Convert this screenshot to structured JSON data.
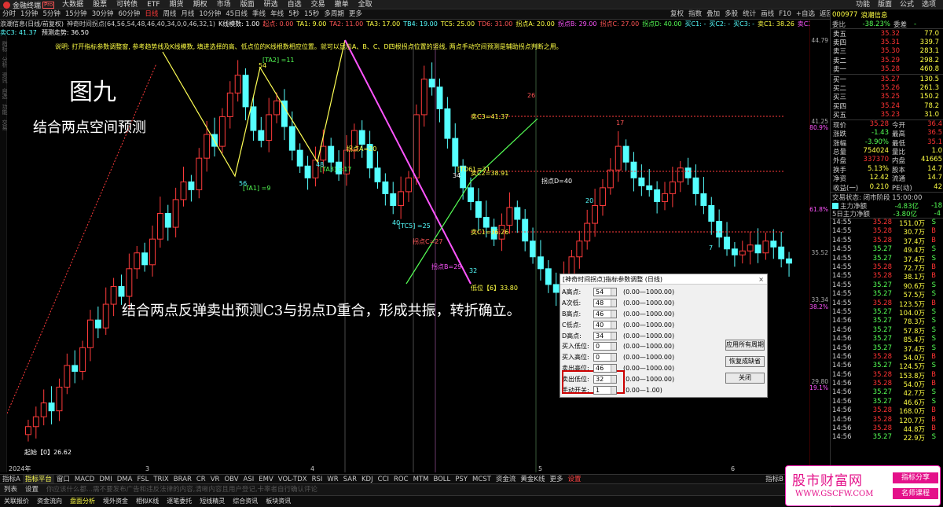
{
  "app": {
    "name": "金融终端",
    "tag": "Pro",
    "menu": [
      "大数据",
      "股票",
      "可转债",
      "ETF",
      "期货",
      "期权",
      "市场",
      "版面",
      "研选",
      "自选",
      "交易",
      "撤单",
      "全取"
    ],
    "right_menu": [
      "功能",
      "版面",
      "公式",
      "选项"
    ]
  },
  "toolbar": {
    "periods": [
      "分时",
      "1分钟",
      "5分钟",
      "15分钟",
      "30分钟",
      "60分钟",
      "日线",
      "周线",
      "月线",
      "10分钟",
      "45日线",
      "季线",
      "年线",
      "5秒",
      "15秒",
      "多周期",
      "更多"
    ],
    "active": "日线",
    "right": [
      "复权",
      "指数",
      "叠加",
      "多股",
      "统计",
      "画线",
      "F10",
      "+自选",
      "返回"
    ]
  },
  "infobar": {
    "stock": "浪潮信息(日线/前复权)",
    "indicator": "神奇时间拐点(64,56,54,48,46,40,34,0,0,46,32,1)",
    "kline": "K线模数: 1.00",
    "items": [
      {
        "t": "起点: 0.00",
        "c": "#f55"
      },
      {
        "t": "TA1: 9.00",
        "c": "#ff4"
      },
      {
        "t": "TA2: 11.00",
        "c": "#f55"
      },
      {
        "t": "TA3: 17.00",
        "c": "#ff4"
      },
      {
        "t": "TB4: 19.00",
        "c": "#5ff"
      },
      {
        "t": "TC5: 25.00",
        "c": "#ff4"
      },
      {
        "t": "TD6: 31.00",
        "c": "#f55"
      },
      {
        "t": "拐点A: 20.00",
        "c": "#ff4"
      },
      {
        "t": "拐点B: 29.00",
        "c": "#f5f"
      },
      {
        "t": "拐点C: 27.00",
        "c": "#f55"
      },
      {
        "t": "拐点D: 40.00",
        "c": "#5f5"
      },
      {
        "t": "买C1: -",
        "c": "#5ff"
      },
      {
        "t": "买C2: -",
        "c": "#5ff"
      },
      {
        "t": "买C3: -",
        "c": "#5ff"
      },
      {
        "t": "卖C1: 38.26",
        "c": "#ff4"
      },
      {
        "t": "卖C2: 38.91",
        "c": "#f5f"
      }
    ],
    "sub1": "卖C3: 41.37",
    "sub2": "预测走势: 36.50"
  },
  "note_strip": "说明: 打开指标参数调整窗, 参考趋势线及K线模数, 填进选择的高、低点位的K线根数相应位置。就可以显示A、B、C、D四根拐点位置的竖线, 两点手动空间预测是辅助拐点判断之用。",
  "figure": {
    "title": "图九",
    "subtitle": "结合两点空间预测",
    "note": "结合两点反弹卖出预测C3与拐点D重合，形成共振，转折确立。"
  },
  "chart_labels": {
    "ta1": "[TA1] =9",
    "ta2": "[TA2] =11",
    "ta3": "[TA3] =17",
    "tc5": "[TC5] =25",
    "td6": "[TD6] =31",
    "A": "拐点A=20",
    "B": "拐点B=29",
    "C": "拐点C=27",
    "D": "拐点D=40",
    "c3": "卖C3=41.37",
    "c2": "卖C2=38.91",
    "c1": "卖C1=36.26",
    "low": "低位【6】33.80",
    "n54": "54",
    "n56": "56",
    "n48": "48",
    "n40": "40",
    "n32": "32",
    "n26": "26",
    "n17": "17",
    "n20": "20",
    "n7": "7",
    "n34": "34",
    "start": "起始【0】26.62",
    "months": [
      "2024年",
      "3",
      "4",
      "5",
      "6"
    ]
  },
  "axis": [
    "44.79",
    "41.25",
    "80.9%",
    "61.8%",
    "35.52",
    "33.34",
    "38.2%",
    "29.80",
    "19.1%"
  ],
  "dialog": {
    "title": "[神奇时间拐点]指标参数调整 (日线)",
    "close": "×",
    "fields": [
      {
        "label": "A高点:",
        "value": "54",
        "range": "(0.00—1000.00)"
      },
      {
        "label": "A次低:",
        "value": "48",
        "range": "(0.00—1000.00)"
      },
      {
        "label": "B高点:",
        "value": "46",
        "range": "(0.00—1000.00)"
      },
      {
        "label": "C低点:",
        "value": "40",
        "range": "(0.00—1000.00)"
      },
      {
        "label": "D高点:",
        "value": "34",
        "range": "(0.00—1000.00)"
      },
      {
        "label": "买入低位:",
        "value": "0",
        "range": "(0.00—1000.00)"
      },
      {
        "label": "买入高位:",
        "value": "0",
        "range": "(0.00—1000.00)"
      },
      {
        "label": "卖出高位:",
        "value": "46",
        "range": "(0.00—1000.00)"
      },
      {
        "label": "卖出低位:",
        "value": "32",
        "range": "(0.00—1000.00)"
      },
      {
        "label": "手动开关:",
        "value": "1",
        "range": "(0.00—1.00)"
      }
    ],
    "buttons": [
      "应用所有周期",
      "恢复成缺省",
      "关闭"
    ]
  },
  "indicator_tabs": [
    "指标A",
    "指标平台",
    "窗口",
    "MACD",
    "DMI",
    "DMA",
    "FSL",
    "TRIX",
    "BRAR",
    "CR",
    "VR",
    "OBV",
    "ASI",
    "EMV",
    "VOL-TDX",
    "RSI",
    "WR",
    "SAR",
    "KDJ",
    "CCI",
    "ROC",
    "MTM",
    "BOLL",
    "PSY",
    "MCST",
    "资金流",
    "黄金K线",
    "更多",
    "设置"
  ],
  "indicator_tab_selected": "指标平台",
  "indicator_right": "指标B",
  "status": {
    "list": "列表",
    "settings": "设置",
    "hint": "你应该什么都...需不要发布广告和违反法律的内容,清晰内容且用户登记,卡率者自行确认评论"
  },
  "nav": [
    "关联报价",
    "资金流向",
    "盘面分析",
    "境外资金",
    "相似K线",
    "逐笔委托",
    "短线精灵",
    "综合资讯",
    "板块资讯"
  ],
  "right_panel": {
    "code": "000977",
    "name": "浪潮信息",
    "ratio_label": "委比",
    "ratio": "-38.23%",
    "diff_label": "委差",
    "diff": "-",
    "asks": [
      {
        "l": "卖五",
        "p": "35.32",
        "v": "77.0"
      },
      {
        "l": "卖四",
        "p": "35.31",
        "v": "339.7"
      },
      {
        "l": "卖三",
        "p": "35.30",
        "v": "283.1"
      },
      {
        "l": "卖二",
        "p": "35.29",
        "v": "298.2"
      },
      {
        "l": "卖一",
        "p": "35.28",
        "v": "460.8"
      }
    ],
    "bids": [
      {
        "l": "买一",
        "p": "35.27",
        "v": "130.5"
      },
      {
        "l": "买二",
        "p": "35.26",
        "v": "261.3"
      },
      {
        "l": "买三",
        "p": "35.25",
        "v": "150.2"
      },
      {
        "l": "买四",
        "p": "35.24",
        "v": "78.2"
      },
      {
        "l": "买五",
        "p": "35.23",
        "v": "31.0"
      }
    ],
    "quote": [
      {
        "k": "现价",
        "v": "35.28",
        "k2": "今开",
        "v2": "36.4"
      },
      {
        "k": "涨跌",
        "v": "-1.43",
        "k2": "最高",
        "v2": "36.5"
      },
      {
        "k": "涨幅",
        "v": "-3.90%",
        "k2": "最低",
        "v2": "35.1"
      },
      {
        "k": "总量",
        "v": "754024",
        "k2": "量比",
        "v2": "1.0"
      },
      {
        "k": "外盘",
        "v": "337370",
        "k2": "内盘",
        "v2": "41665"
      },
      {
        "k": "换手",
        "v": "5.13%",
        "k2": "股本",
        "v2": "14.7"
      },
      {
        "k": "净资",
        "v": "12.42",
        "k2": "流通",
        "v2": "14.7"
      },
      {
        "k": "收益(一)",
        "v": "0.210",
        "k2": "PE(动)",
        "v2": "42"
      }
    ],
    "trade_status": "交易状态: 闭市阶段 15:00:00",
    "flow1": {
      "k": "主力净额",
      "v": "-4.83亿",
      "v2": "-18"
    },
    "flow2": {
      "k": "5日主力净额",
      "v": "-3.80亿",
      "v2": "-4"
    },
    "ticks": [
      {
        "t": "14:55",
        "p": "35.28",
        "v": "151.0万",
        "s": "S"
      },
      {
        "t": "14:55",
        "p": "35.28",
        "v": "30.7万",
        "s": "B"
      },
      {
        "t": "14:55",
        "p": "35.28",
        "v": "37.4万",
        "s": "B"
      },
      {
        "t": "14:55",
        "p": "35.27",
        "v": "49.4万",
        "s": "S"
      },
      {
        "t": "14:55",
        "p": "35.27",
        "v": "37.4万",
        "s": "S"
      },
      {
        "t": "14:55",
        "p": "35.28",
        "v": "72.7万",
        "s": "B"
      },
      {
        "t": "14:55",
        "p": "35.28",
        "v": "38.1万",
        "s": "B"
      },
      {
        "t": "14:55",
        "p": "35.27",
        "v": "90.6万",
        "s": "S"
      },
      {
        "t": "14:55",
        "p": "35.27",
        "v": "57.5万",
        "s": "S"
      },
      {
        "t": "14:55",
        "p": "35.28",
        "v": "123.5万",
        "s": "B"
      },
      {
        "t": "14:55",
        "p": "35.27",
        "v": "104.0万",
        "s": "S"
      },
      {
        "t": "14:56",
        "p": "35.27",
        "v": "78.3万",
        "s": "S"
      },
      {
        "t": "14:56",
        "p": "35.27",
        "v": "57.8万",
        "s": "S"
      },
      {
        "t": "14:56",
        "p": "35.27",
        "v": "85.4万",
        "s": "S"
      },
      {
        "t": "14:56",
        "p": "35.27",
        "v": "37.4万",
        "s": "S"
      },
      {
        "t": "14:56",
        "p": "35.28",
        "v": "54.0万",
        "s": "B"
      },
      {
        "t": "14:56",
        "p": "35.27",
        "v": "124.5万",
        "s": "S"
      },
      {
        "t": "14:56",
        "p": "35.28",
        "v": "153.8万",
        "s": "B"
      },
      {
        "t": "14:56",
        "p": "35.28",
        "v": "54.0万",
        "s": "B"
      },
      {
        "t": "14:56",
        "p": "35.27",
        "v": "42.7万",
        "s": "S"
      },
      {
        "t": "14:56",
        "p": "35.27",
        "v": "46.6万",
        "s": "S"
      },
      {
        "t": "14:56",
        "p": "35.28",
        "v": "168.0万",
        "s": "B"
      },
      {
        "t": "14:56",
        "p": "35.28",
        "v": "120.7万",
        "s": "B"
      },
      {
        "t": "14:56",
        "p": "35.28",
        "v": "44.8万",
        "s": "B"
      },
      {
        "t": "14:56",
        "p": "35.27",
        "v": "22.9万",
        "s": "S"
      }
    ]
  },
  "watermark": {
    "title": "股市财富网",
    "url": "WWW.GSCFW.COM",
    "tag1": "指标分享",
    "tag2": "名师课程"
  }
}
